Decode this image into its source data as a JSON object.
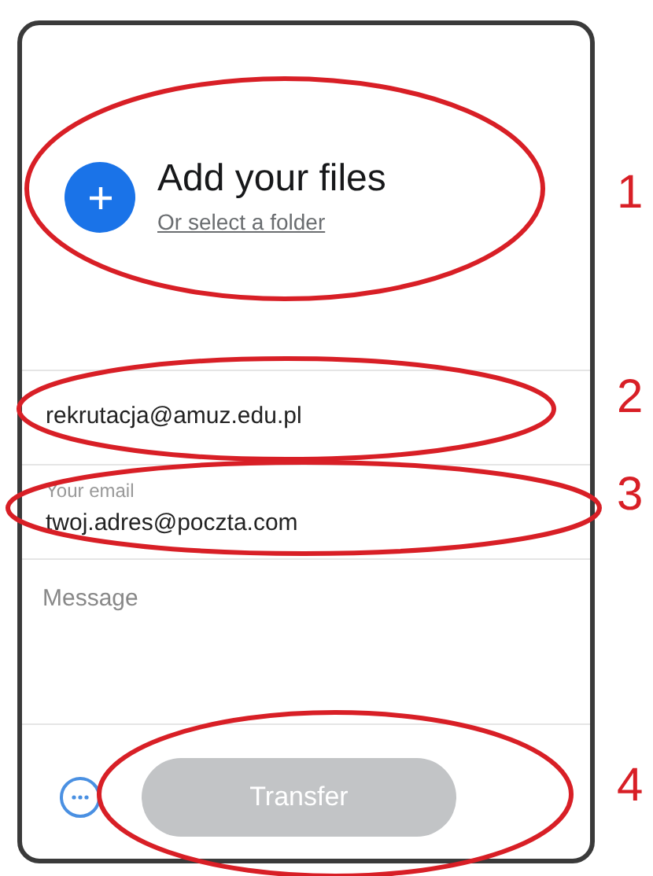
{
  "upload": {
    "title": "Add your files",
    "link": "Or select a folder"
  },
  "fields": [
    {
      "kind": "plain",
      "value": "rekrutacja@amuz.edu.pl"
    },
    {
      "kind": "labeled",
      "label": "Your email",
      "value": "twoj.adres@poczta.com"
    },
    {
      "kind": "message",
      "placeholder": "Message"
    }
  ],
  "footer": {
    "button": "Transfer",
    "disabled": true
  },
  "annotations": [
    {
      "label": "1"
    },
    {
      "label": "2"
    },
    {
      "label": "3"
    },
    {
      "label": "4"
    }
  ]
}
